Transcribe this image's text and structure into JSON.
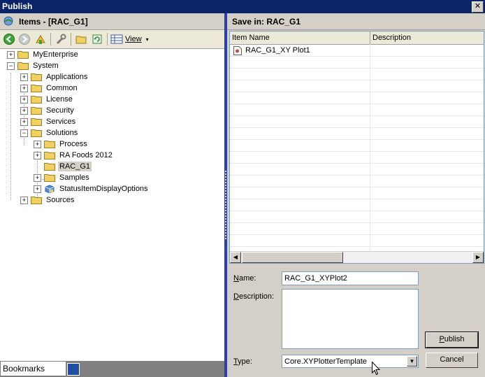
{
  "window": {
    "title": "Publish",
    "close_label": "✕"
  },
  "left_pane": {
    "header": "Items - [RAC_G1]",
    "toolbar": {
      "view_label": "View",
      "view_caret": "▾"
    },
    "tree": [
      {
        "label": "MyEnterprise",
        "expander": "+"
      },
      {
        "label": "System",
        "expander": "−"
      },
      {
        "label": "Applications",
        "expander": "+"
      },
      {
        "label": "Common",
        "expander": "+"
      },
      {
        "label": "License",
        "expander": "+"
      },
      {
        "label": "Security",
        "expander": "+"
      },
      {
        "label": "Services",
        "expander": "+"
      },
      {
        "label": "Solutions",
        "expander": "−"
      },
      {
        "label": "Process",
        "expander": "+"
      },
      {
        "label": "RA Foods 2012",
        "expander": "+"
      },
      {
        "label": "RAC_G1",
        "expander": ""
      },
      {
        "label": "Samples",
        "expander": "+"
      },
      {
        "label": "StatusItemDisplayOptions",
        "expander": "+"
      },
      {
        "label": "Sources",
        "expander": "+"
      }
    ],
    "bookmarks_label": "Bookmarks"
  },
  "right_pane": {
    "header": "Save in:  RAC_G1",
    "grid": {
      "columns": [
        "Item Name",
        "Description"
      ],
      "rows": [
        {
          "name": "RAC_G1_XY Plot1",
          "description": ""
        }
      ]
    },
    "scroll": {
      "left": "◀",
      "right": "▶"
    },
    "form": {
      "name_label_u": "N",
      "name_label_rest": "ame:",
      "name_value": "RAC_G1_XYPlot2",
      "description_label_u": "D",
      "description_label_rest": "escription:",
      "description_value": "",
      "type_label_u": "T",
      "type_label_rest": "ype:",
      "type_value": "Core.XYPlotterTemplate",
      "type_caret": "▼",
      "publish_label_u": "P",
      "publish_label_rest": "ublish",
      "cancel_label": "Cancel"
    }
  },
  "colors": {
    "title_bar": "#0a246a",
    "splitter": "#2a3fb0",
    "folder": "#f0d060",
    "selection": "#d4d0c8"
  }
}
